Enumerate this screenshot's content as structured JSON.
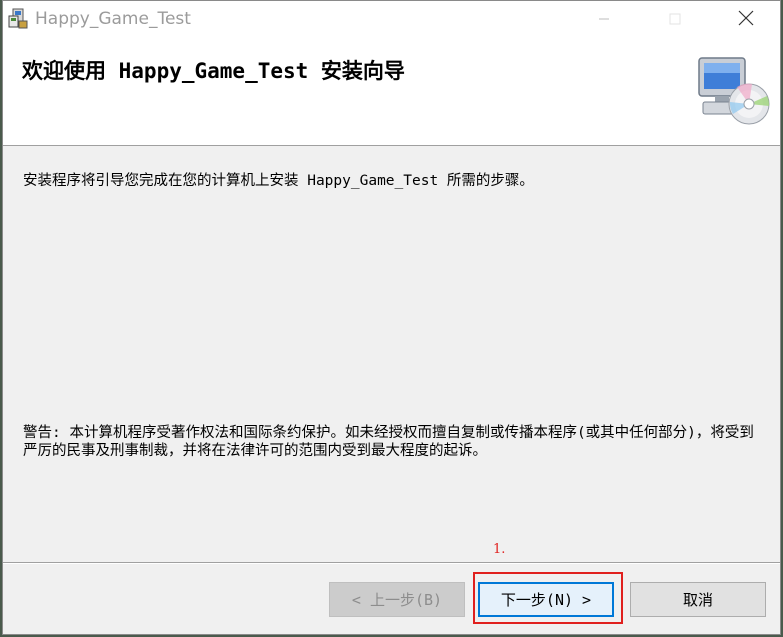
{
  "window": {
    "title": "Happy_Game_Test",
    "icons": {
      "app": "installer-app-icon",
      "minimize": "minimize-icon",
      "maximize": "maximize-icon",
      "close": "close-icon",
      "header_art": "computer-cd-icon"
    }
  },
  "header": {
    "title": "欢迎使用 Happy_Game_Test 安装向导"
  },
  "body": {
    "intro": "安装程序将引导您完成在您的计算机上安装 Happy_Game_Test 所需的步骤。",
    "warning": "警告: 本计算机程序受著作权法和国际条约保护。如未经授权而擅自复制或传播本程序(或其中任何部分)，将受到严厉的民事及刑事制裁，并将在法律许可的范围内受到最大程度的起诉。"
  },
  "annotation": {
    "label": "1."
  },
  "footer": {
    "back_label": "< 上一步(B)",
    "next_label": "下一步(N) >",
    "cancel_label": "取消"
  },
  "colors": {
    "annotation": "#e0201e",
    "focus": "#0078d7"
  }
}
